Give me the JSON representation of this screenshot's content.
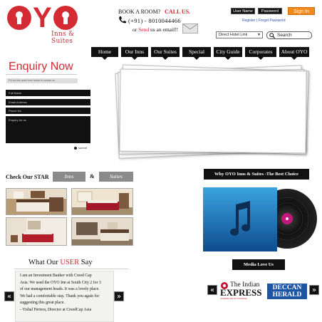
{
  "brand": {
    "logo_word": "OYO",
    "logo_sub": "Inns & Suites",
    "primary_color": "#d42a33",
    "accent_color": "#f08a1c"
  },
  "contact": {
    "book_label": "BOOK A ROOM?",
    "call_label": "CALL US.",
    "phone": "(+91) - 8010044466",
    "email_prefix": "or",
    "email_send": "Send",
    "email_suffix": "us an email!!"
  },
  "account": {
    "username_placeholder": "User Name",
    "password_placeholder": "Password",
    "signin_label": "Sign In",
    "register_label": "Register",
    "separator": "|",
    "forgot_label": "Forget Password"
  },
  "direct_link": {
    "label": "Direct Hotel Link"
  },
  "search": {
    "placeholder": "Search",
    "icon": "search-icon"
  },
  "nav": {
    "items": [
      {
        "label": "Home"
      },
      {
        "label": "Our Inns"
      },
      {
        "label": "Our Suites"
      },
      {
        "label": "Special Offer"
      },
      {
        "label": "City Guide"
      },
      {
        "label": "Corporates"
      },
      {
        "label": "About OYO"
      }
    ]
  },
  "enquiry": {
    "title": "Enquiry Now",
    "note": "Fill out this quick form below to contact us.",
    "fields": {
      "full_name": "Full Name",
      "email": "Email Address",
      "phone": "Phone No",
      "enquiry": "Enquiry for us"
    },
    "submit_label": "submit"
  },
  "showcase": {
    "check_label": "Check Our STAR",
    "tab_inns": "Inns",
    "amp": "&",
    "tab_suites": "Suites"
  },
  "best_choice": {
    "label": "Why OYO Inns & Suites -The Best Choice"
  },
  "testimonials": {
    "heading_prefix": "What Our",
    "heading_highlight": "USER",
    "heading_suffix": "Say",
    "lines": [
      "I am an Investment Banker with Creed Cap",
      "Asia. We used the OYO Inn at South City 2 for 3",
      "of our management heads. It was a lovely place.",
      "We had a comfortable stay. Thank you again for",
      "suggesting this great place.",
      "- Vishal Periera, Director at CreedCap Asia"
    ],
    "prev_icon": "double-chevron-left-icon",
    "next_icon": "double-chevron-right-icon"
  },
  "media": {
    "label": "Media Love Us",
    "indian_express": {
      "line1": "The Indian",
      "line2": "EXPRESS",
      "tagline": "JOURNALISM OF COURAGE"
    },
    "deccan_herald": {
      "line1": "DECCAN",
      "line2": "HERALD"
    }
  }
}
